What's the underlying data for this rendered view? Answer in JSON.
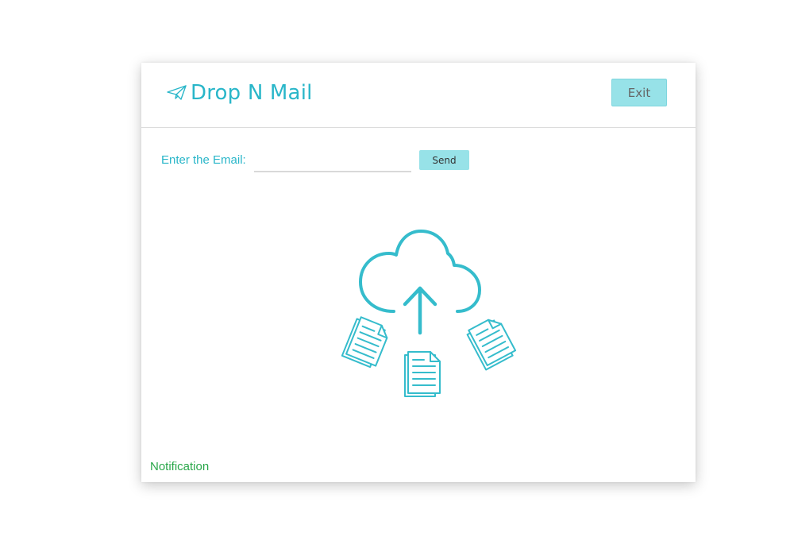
{
  "app": {
    "title": "Drop N Mail",
    "exit_label": "Exit"
  },
  "form": {
    "email_label": "Enter the Email:",
    "email_value": "",
    "send_label": "Send"
  },
  "upload": {
    "icon": "cloud-upload-documents-icon"
  },
  "status": {
    "notification": "Notification"
  },
  "colors": {
    "accent": "#29b6c9",
    "button_bg": "#97e2e8",
    "notification": "#2aa74a"
  }
}
